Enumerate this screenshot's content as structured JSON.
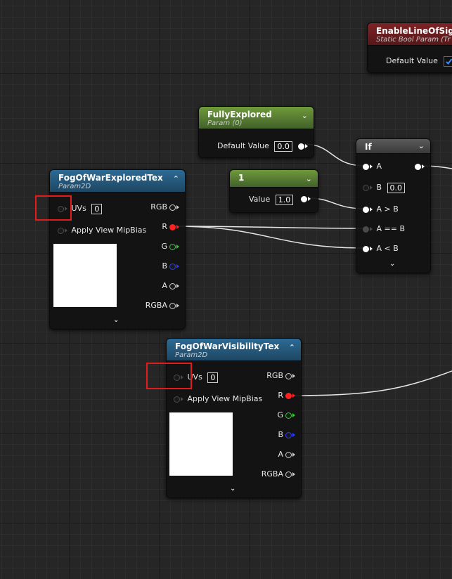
{
  "nodes": {
    "enable_line_of_sight": {
      "title": "EnableLineOfSight",
      "subtitle": "Static Bool Param (Tr",
      "default_label": "Default Value",
      "default_checked": true,
      "color": "#7e2326"
    },
    "fully_explored": {
      "title": "FullyExplored",
      "subtitle": "Param (0)",
      "default_label": "Default Value",
      "default_value": "0.0",
      "color": "#6f9a3b"
    },
    "constant_one": {
      "title": "1",
      "value_label": "Value",
      "value": "1.0",
      "color": "#6f9a3b"
    },
    "if_node": {
      "title": "If",
      "inputs": {
        "a": "A",
        "b": "B",
        "b_value": "0.0",
        "a_gt_b": "A > B",
        "a_eq_b": "A == B",
        "a_lt_b": "A < B"
      },
      "color": "#5b5b5b"
    },
    "fog_explored_tex": {
      "title": "FogOfWarExploredTex",
      "subtitle": "Param2D",
      "uvs_label": "UVs",
      "uvs_value": "0",
      "mipbias_label": "Apply View MipBias",
      "outputs": {
        "rgb": "RGB",
        "r": "R",
        "g": "G",
        "b": "B",
        "a": "A",
        "rgba": "RGBA"
      },
      "color": "#2c6a94"
    },
    "fog_visibility_tex": {
      "title": "FogOfWarVisibilityTex",
      "subtitle": "Param2D",
      "uvs_label": "UVs",
      "uvs_value": "0",
      "mipbias_label": "Apply View MipBias",
      "outputs": {
        "rgb": "RGB",
        "r": "R",
        "g": "G",
        "b": "B",
        "a": "A",
        "rgba": "RGBA"
      },
      "color": "#2c6a94"
    }
  },
  "icons": {
    "collapse": "chevron-up-icon",
    "expand": "chevron-down-icon",
    "check": "checkmark-icon"
  },
  "colors": {
    "highlight": "#e21c1c",
    "pin_red": "#ff2020",
    "pin_green": "#33cc33",
    "pin_blue": "#2a3cff",
    "graph_background": "#262626"
  }
}
